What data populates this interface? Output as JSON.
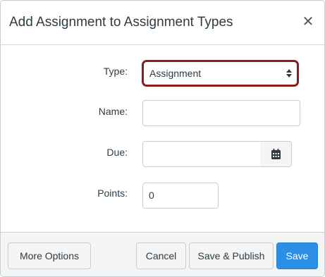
{
  "dialog": {
    "title": "Add Assignment to Assignment Types",
    "close_icon": "close-icon"
  },
  "form": {
    "type": {
      "label": "Type:",
      "value": "Assignment",
      "icon": "updown-arrows-icon"
    },
    "name": {
      "label": "Name:",
      "value": ""
    },
    "due": {
      "label": "Due:",
      "value": "",
      "icon": "calendar-icon"
    },
    "points": {
      "label": "Points:",
      "value": "0"
    }
  },
  "footer": {
    "more_options": "More Options",
    "cancel": "Cancel",
    "save_publish": "Save & Publish",
    "save": "Save"
  },
  "colors": {
    "focus_border": "#8b1c1c",
    "primary": "#2d8ee5",
    "text": "#2d3b45",
    "footer_bg": "#f5f5f5"
  }
}
